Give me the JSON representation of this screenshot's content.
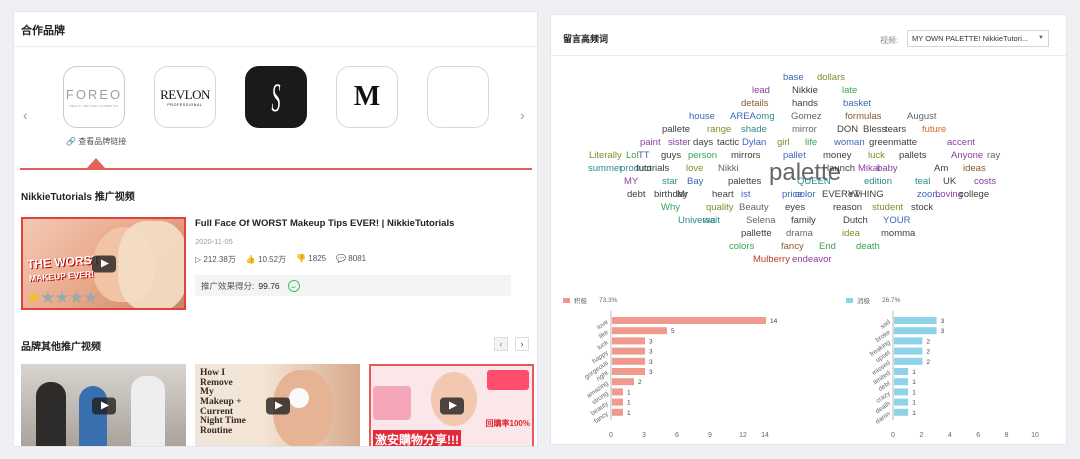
{
  "left_panel": {
    "title": "合作品牌",
    "brand_link": "查看品牌链接",
    "brands": [
      {
        "name": "FOREO",
        "tagline": "BEAUTY BEYOND COSMETICS"
      },
      {
        "name": "REVLON",
        "tagline": "PROFESSIONAL"
      },
      {
        "name": "S"
      },
      {
        "name": "M"
      },
      {
        "name": ""
      }
    ],
    "promo_title": "NikkieTutorials 推广视频",
    "promo_video": {
      "thumb_text_1": "THE WORST",
      "thumb_text_2": "MAKEUP EVER!",
      "title": "Full Face Of WORST Makeup Tips EVER! | NikkieTutorials",
      "date": "2020-11-05",
      "views": "212.38万",
      "likes": "10.52万",
      "dislikes": "1825",
      "comments": "8081",
      "score_label": "推广效果得分:",
      "score": "99.76"
    },
    "other_title": "品牌其他推广视频",
    "other_videos": [
      {
        "thumb_text": ""
      },
      {
        "thumb_text": "How I Remove My Makeup + Current Night Time Routine"
      },
      {
        "thumb_text": "激安購物分享!!!",
        "badge": "回購率100%"
      }
    ]
  },
  "right_panel": {
    "title": "留言高频词",
    "video_label": "视频:",
    "video_select": "MY OWN PALETTE! NikkieTutori...",
    "cloud_colors": {
      "blue": "#3b66b8",
      "olive": "#7a8f2a",
      "green": "#3aa251",
      "brown": "#8b5a2b",
      "purple": "#8a3f9e",
      "teal": "#2a8a8a",
      "red": "#c0392b",
      "grey": "#666666",
      "dark": "#3d3d3d",
      "orange": "#d2691e"
    },
    "word_cloud": [
      {
        "text": "base",
        "color": "blue"
      },
      {
        "text": "dollars",
        "color": "olive"
      },
      {
        "text": "lead",
        "color": "purple"
      },
      {
        "text": "Nikkie",
        "color": "dark"
      },
      {
        "text": "late",
        "color": "green"
      },
      {
        "text": "details",
        "color": "brown"
      },
      {
        "text": "hands",
        "color": "dark"
      },
      {
        "text": "basket",
        "color": "blue"
      },
      {
        "text": "house",
        "color": "blue"
      },
      {
        "text": "AREA",
        "color": "blue"
      },
      {
        "text": "omg",
        "color": "teal"
      },
      {
        "text": "Gomez",
        "color": "grey"
      },
      {
        "text": "formulas",
        "color": "brown"
      },
      {
        "text": "August",
        "color": "grey"
      },
      {
        "text": "pallete",
        "color": "dark"
      },
      {
        "text": "range",
        "color": "olive"
      },
      {
        "text": "shade",
        "color": "teal"
      },
      {
        "text": "mirror",
        "color": "grey"
      },
      {
        "text": "DON",
        "color": "dark"
      },
      {
        "text": "Bless",
        "color": "dark"
      },
      {
        "text": "tears",
        "color": "dark"
      },
      {
        "text": "future",
        "color": "orange"
      },
      {
        "text": "paint",
        "color": "purple"
      },
      {
        "text": "sister",
        "color": "purple"
      },
      {
        "text": "days",
        "color": "dark"
      },
      {
        "text": "tactic",
        "color": "dark"
      },
      {
        "text": "Dylan",
        "color": "blue"
      },
      {
        "text": "girl",
        "color": "olive"
      },
      {
        "text": "life",
        "color": "green"
      },
      {
        "text": "woman",
        "color": "blue"
      },
      {
        "text": "greenmatte",
        "color": "dark"
      },
      {
        "text": "accent",
        "color": "purple"
      },
      {
        "text": "Literally",
        "color": "olive"
      },
      {
        "text": "Lol",
        "color": "green"
      },
      {
        "text": "TT",
        "color": "blue"
      },
      {
        "text": "guys",
        "color": "dark"
      },
      {
        "text": "person",
        "color": "green"
      },
      {
        "text": "mirrors",
        "color": "dark"
      },
      {
        "text": "pallet",
        "color": "blue"
      },
      {
        "text": "money",
        "color": "dark"
      },
      {
        "text": "luck",
        "color": "olive"
      },
      {
        "text": "pallets",
        "color": "dark"
      },
      {
        "text": "Anyone",
        "color": "purple"
      },
      {
        "text": "ray",
        "color": "grey"
      },
      {
        "text": "summer",
        "color": "teal"
      },
      {
        "text": "product",
        "color": "teal"
      },
      {
        "text": "tutorials",
        "color": "dark"
      },
      {
        "text": "love",
        "color": "olive"
      },
      {
        "text": "Nikki",
        "color": "grey"
      },
      {
        "text": "palette",
        "color": "grey"
      },
      {
        "text": "launch",
        "color": "dark"
      },
      {
        "text": "Mikai",
        "color": "purple"
      },
      {
        "text": "baby",
        "color": "purple"
      },
      {
        "text": "Am",
        "color": "dark"
      },
      {
        "text": "ideas",
        "color": "brown"
      },
      {
        "text": "MY",
        "color": "purple"
      },
      {
        "text": "star",
        "color": "teal"
      },
      {
        "text": "Bay",
        "color": "blue"
      },
      {
        "text": "palettes",
        "color": "dark"
      },
      {
        "text": "QUEEN",
        "color": "teal"
      },
      {
        "text": "edition",
        "color": "teal"
      },
      {
        "text": "teal",
        "color": "teal"
      },
      {
        "text": "UK",
        "color": "dark"
      },
      {
        "text": "costs",
        "color": "purple"
      },
      {
        "text": "debt",
        "color": "dark"
      },
      {
        "text": "birthday",
        "color": "dark"
      },
      {
        "text": "Mr",
        "color": "dark"
      },
      {
        "text": "heart",
        "color": "dark"
      },
      {
        "text": "ist",
        "color": "blue"
      },
      {
        "text": "price",
        "color": "blue"
      },
      {
        "text": "color",
        "color": "blue"
      },
      {
        "text": "EVERYTHING",
        "color": "dark"
      },
      {
        "text": "ew",
        "color": "dark"
      },
      {
        "text": "zoom",
        "color": "blue"
      },
      {
        "text": "Loving",
        "color": "purple"
      },
      {
        "text": "college",
        "color": "dark"
      },
      {
        "text": "Why",
        "color": "green"
      },
      {
        "text": "quality",
        "color": "olive"
      },
      {
        "text": "Beauty",
        "color": "grey"
      },
      {
        "text": "eyes",
        "color": "dark"
      },
      {
        "text": "reason",
        "color": "dark"
      },
      {
        "text": "student",
        "color": "olive"
      },
      {
        "text": "stock",
        "color": "dark"
      },
      {
        "text": "Universe",
        "color": "teal"
      },
      {
        "text": "wait",
        "color": "teal"
      },
      {
        "text": "Selena",
        "color": "grey"
      },
      {
        "text": "family",
        "color": "dark"
      },
      {
        "text": "Dutch",
        "color": "dark"
      },
      {
        "text": "YOUR",
        "color": "blue"
      },
      {
        "text": "pallette",
        "color": "dark"
      },
      {
        "text": "drama",
        "color": "grey"
      },
      {
        "text": "idea",
        "color": "olive"
      },
      {
        "text": "momma",
        "color": "dark"
      },
      {
        "text": "colors",
        "color": "green"
      },
      {
        "text": "fancy",
        "color": "brown"
      },
      {
        "text": "End",
        "color": "green"
      },
      {
        "text": "death",
        "color": "green"
      },
      {
        "text": "Mulberry",
        "color": "red"
      },
      {
        "text": "endeavor",
        "color": "purple"
      }
    ]
  },
  "chart_data": [
    {
      "type": "bar",
      "orientation": "horizontal",
      "series_name": "积极",
      "share": "73.3%",
      "color": "#f0998d",
      "categories": [
        "love",
        "like",
        "luck",
        "happy",
        "gorgeous",
        "right",
        "amazing",
        "strong",
        "beauty",
        "fancy"
      ],
      "values": [
        14,
        5,
        3,
        3,
        3,
        3,
        2,
        1,
        1,
        1
      ],
      "xlim": [
        0,
        16
      ],
      "xticks": [
        "0",
        "3",
        "6",
        "9",
        "12",
        "14"
      ]
    },
    {
      "type": "bar",
      "orientation": "horizontal",
      "series_name": "消极",
      "share": "26.7%",
      "color": "#8fd3ea",
      "categories": [
        "sad",
        "broke",
        "freaking",
        "upset",
        "missed",
        "limited",
        "debt",
        "crazy",
        "death",
        "damn"
      ],
      "values": [
        3,
        3,
        2,
        2,
        2,
        1,
        1,
        1,
        1,
        1
      ],
      "xlim": [
        0,
        10
      ],
      "xticks": [
        "0",
        "2",
        "4",
        "6",
        "8",
        "10"
      ]
    }
  ]
}
